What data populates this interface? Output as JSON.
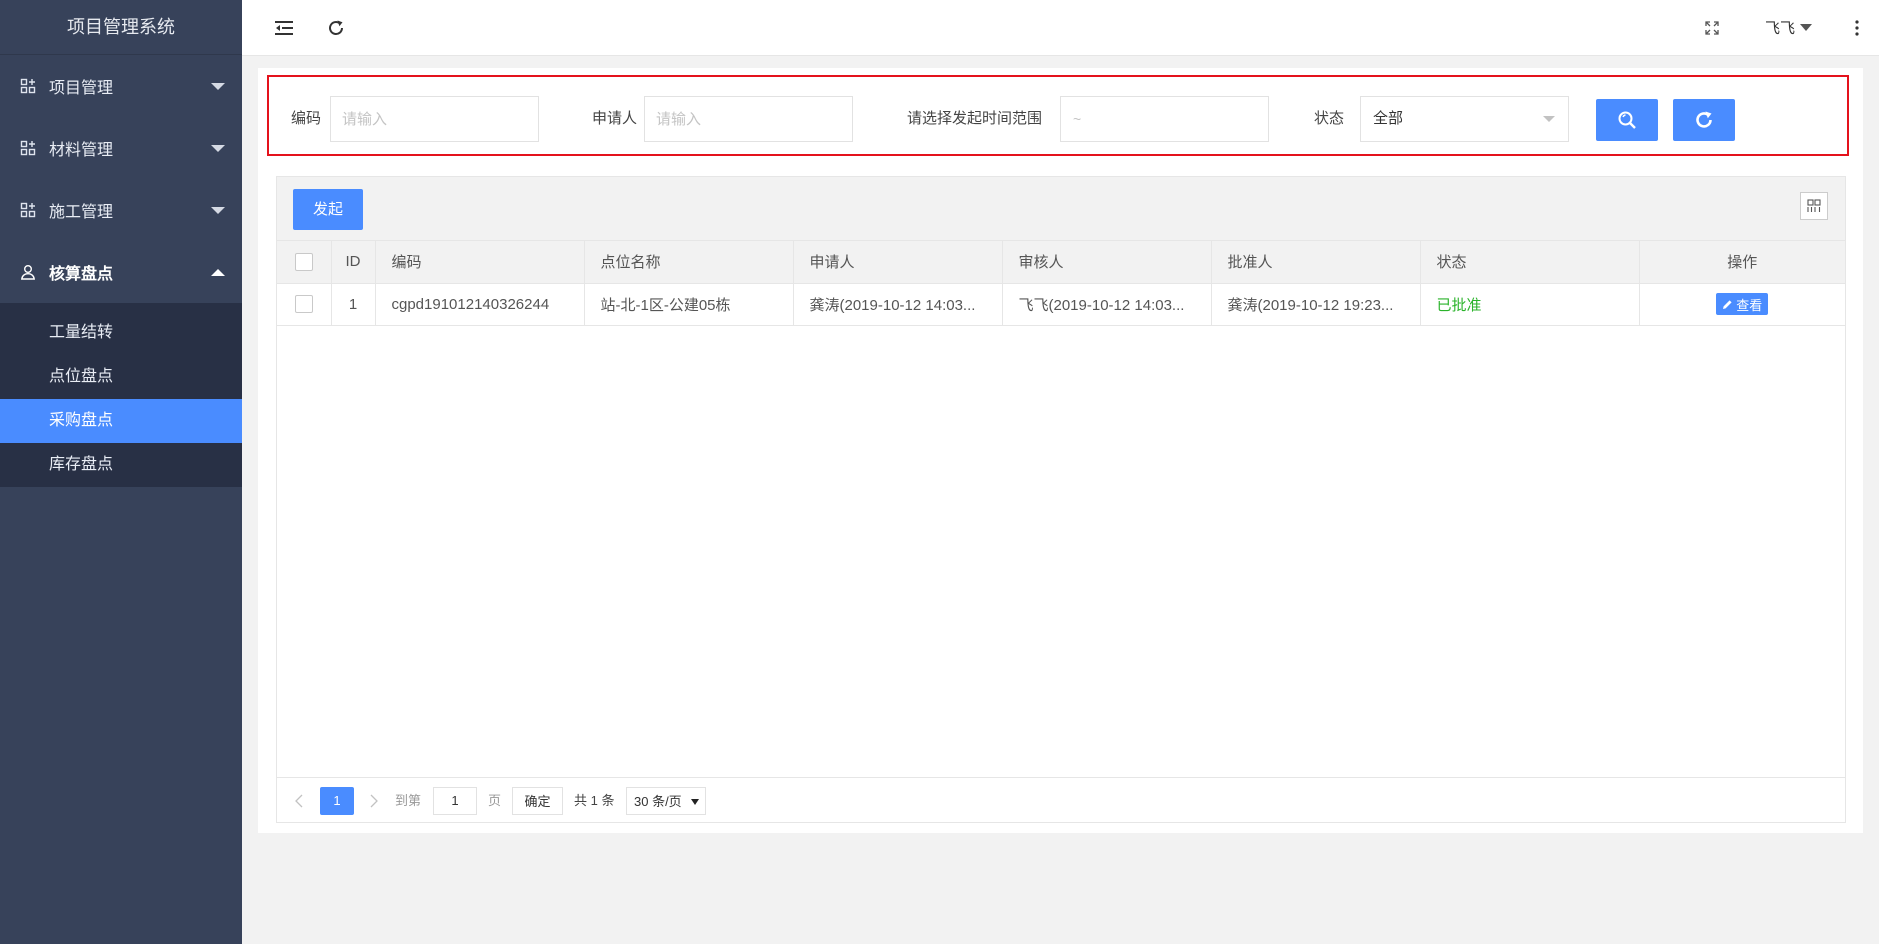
{
  "app": {
    "title": "项目管理系统"
  },
  "sidebar": {
    "groups": [
      {
        "label": "项目管理",
        "expanded": false
      },
      {
        "label": "材料管理",
        "expanded": false
      },
      {
        "label": "施工管理",
        "expanded": false
      },
      {
        "label": "核算盘点",
        "expanded": true
      }
    ],
    "sub_items": [
      {
        "label": "工量结转",
        "active": false
      },
      {
        "label": "点位盘点",
        "active": false
      },
      {
        "label": "采购盘点",
        "active": true
      },
      {
        "label": "库存盘点",
        "active": false
      }
    ]
  },
  "topbar": {
    "user": "飞飞"
  },
  "filters": {
    "code_label": "编码",
    "code_placeholder": "请输入",
    "applicant_label": "申请人",
    "applicant_placeholder": "请输入",
    "date_label": "请选择发起时间范围",
    "date_placeholder": "~",
    "status_label": "状态",
    "status_value": "全部"
  },
  "toolbar": {
    "launch_label": "发起"
  },
  "table": {
    "columns": [
      "ID",
      "编码",
      "点位名称",
      "申请人",
      "审核人",
      "批准人",
      "状态",
      "操作"
    ],
    "rows": [
      {
        "id": "1",
        "code": "cgpd191012140326244",
        "location": "站-北-1区-公建05栋",
        "applicant": "龚涛(2019-10-12 14:03...",
        "reviewer": "飞飞(2019-10-12 14:03...",
        "approver": "龚涛(2019-10-12 19:23...",
        "status": "已批准",
        "action": "查看"
      }
    ]
  },
  "pagination": {
    "current_page": "1",
    "goto_prefix": "到第",
    "goto_value": "1",
    "goto_suffix": "页",
    "confirm": "确定",
    "total": "共 1 条",
    "page_size": "30 条/页"
  },
  "colors": {
    "accent": "#4a8cff",
    "sidebar": "#37425a",
    "highlight_border": "#e4121c",
    "success": "#2bb32b"
  }
}
